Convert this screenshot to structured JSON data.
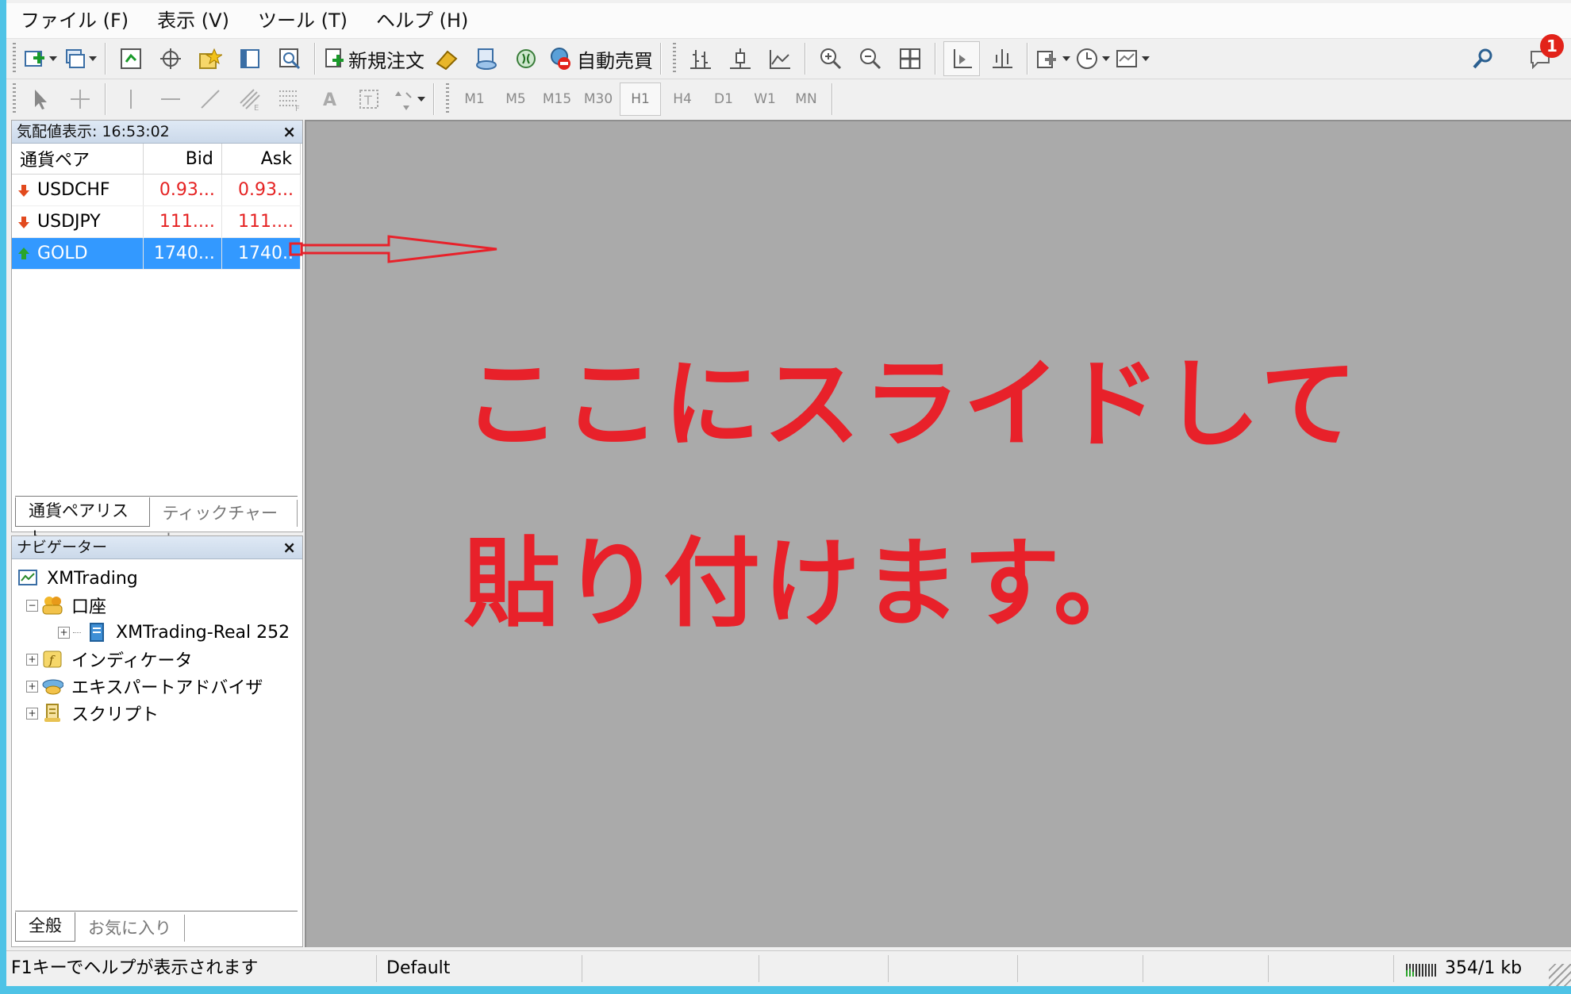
{
  "menu": [
    "ファイル (F)",
    "表示 (V)",
    "ツール (T)",
    "ヘルプ (H)"
  ],
  "toolbar": {
    "new_order_label": "新規注文",
    "auto_trade_label": "自動売買",
    "notification_count": "1"
  },
  "timeframes": [
    "M1",
    "M5",
    "M15",
    "M30",
    "H1",
    "H4",
    "D1",
    "W1",
    "MN"
  ],
  "timeframe_active": "H1",
  "market_watch": {
    "title": "気配値表示: 16:53:02",
    "close": "×",
    "columns": [
      "通貨ペア",
      "Bid",
      "Ask"
    ],
    "rows": [
      {
        "symbol": "USDCHF",
        "bid": "0.93...",
        "ask": "0.93...",
        "direction": "down"
      },
      {
        "symbol": "USDJPY",
        "bid": "111....",
        "ask": "111....",
        "direction": "down"
      },
      {
        "symbol": "GOLD",
        "bid": "1740...",
        "ask": "1740..",
        "direction": "up",
        "selected": true
      }
    ],
    "tabs": [
      "通貨ペアリスト",
      "ティックチャート"
    ]
  },
  "navigator": {
    "title": "ナビゲーター",
    "close": "×",
    "items": {
      "root": "XMTrading",
      "accounts": "口座",
      "account": "XMTrading-Real 252",
      "indicators": "インディケータ",
      "experts": "エキスパートアドバイザ",
      "scripts": "スクリプト"
    },
    "tabs": [
      "全般",
      "お気に入り"
    ]
  },
  "annotation": {
    "line1": "ここにスライドして",
    "line2": "貼り付けます。",
    "color": "#e8212a"
  },
  "status": {
    "help": "F1キーでヘルプが表示されます",
    "profile": "Default",
    "traffic": "354/1 kb"
  }
}
